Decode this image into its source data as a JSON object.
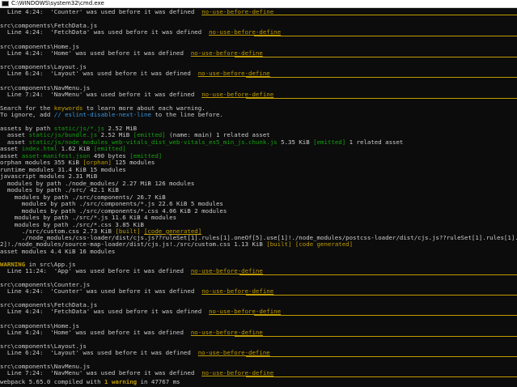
{
  "window": {
    "title": "C:\\WINDOWS\\system32\\cmd.exe"
  },
  "lines": {
    "l00": {
      "a": "  Line 4:24:  'Counter' was used before it was defined  ",
      "r": "no-use-before-define"
    },
    "l01": "src\\components\\FetchData.js",
    "l02": {
      "a": "  Line 4:24:  'FetchData' was used before it was defined  ",
      "r": "no-use-before-define"
    },
    "l03": "src\\components\\Home.js",
    "l04": {
      "a": "  Line 4:24:  'Home' was used before it was defined  ",
      "r": "no-use-before-define"
    },
    "l05": "src\\components\\Layout.js",
    "l06": {
      "a": "  Line 6:24:  'Layout' was used before it was defined  ",
      "r": "no-use-before-define"
    },
    "l07": "src\\components\\NavMenu.js",
    "l08": {
      "a": "  Line 7:24:  'NavMenu' was used before it was defined  ",
      "r": "no-use-before-define"
    },
    "l09": {
      "a": "Search for the ",
      "k": "keywords",
      "b": " to learn more about each warning."
    },
    "l10": {
      "a": "To ignore, add ",
      "k": "// eslint-disable-next-line",
      "b": " to the line before."
    },
    "l11": {
      "a": "assets by path ",
      "k": "static/js/*.js",
      "b": " 2.52 MiB"
    },
    "l12": {
      "a": "  asset ",
      "k": "static/js/bundle.js",
      "b": " 2.52 MiB ",
      "t": "[emitted]",
      "c": " (name: main) 1 related asset"
    },
    "l13": {
      "a": "  asset ",
      "k": "static/js/node_modules_web-vitals_dist_web-vitals_es5_min_js.chunk.js",
      "b": " 5.35 KiB ",
      "t": "[emitted]",
      "c": " 1 related asset"
    },
    "l14": {
      "a": "asset ",
      "k": "index.html",
      "b": " 1.62 KiB ",
      "t": "[emitted]"
    },
    "l15": {
      "a": "asset ",
      "k": "asset-manifest.json",
      "b": " 490 bytes ",
      "t": "[emitted]"
    },
    "l16": {
      "a": "orphan modules 355 KiB ",
      "t": "[orphan]",
      "b": " 125 modules"
    },
    "l17": "runtime modules 31.4 KiB 15 modules",
    "l18": "javascript modules 2.31 MiB",
    "l19": "  modules by path ./node_modules/ 2.27 MiB 126 modules",
    "l20": "  modules by path ./src/ 42.1 KiB",
    "l21": "    modules by path ./src/components/ 26.7 KiB",
    "l22": "      modules by path ./src/components/*.js 22.6 KiB 5 modules",
    "l23": "      modules by path ./src/components/*.css 4.06 KiB 2 modules",
    "l24": "    modules by path ./src/*.js 11.6 KiB 4 modules",
    "l25": "    modules by path ./src/*.css 3.85 KiB",
    "l26": {
      "a": "      ./src/custom.css 2.73 KiB ",
      "t": "[built]",
      "b": " ",
      "u": "[code generated]"
    },
    "l27": "      ./node_modules/css-loader/dist/cjs.js??ruleSet[1].rules[1].oneOf[5].use[1]!./node_modules/postcss-loader/dist/cjs.js??ruleSet[1].rules[1].oneOf[5].use[",
    "l28": {
      "a": "2]!./node_modules/source-map-loader/dist/cjs.js!./src/custom.css 1.13 KiB ",
      "t": "[built]",
      "b": " ",
      "u": "[code generated]"
    },
    "l29": "asset modules 4.4 KiB 16 modules",
    "l30": {
      "w": "WARNING",
      "a": " in src\\App.js"
    },
    "l31": {
      "a": "  Line 11:24:  'App' was used before it was defined  ",
      "r": "no-use-before-define"
    },
    "l32": "src\\components\\Counter.js",
    "l33": {
      "a": "  Line 4:24:  'Counter' was used before it was defined  ",
      "r": "no-use-before-define"
    },
    "l34": "src\\components\\FetchData.js",
    "l35": {
      "a": "  Line 4:24:  'FetchData' was used before it was defined  ",
      "r": "no-use-before-define"
    },
    "l36": "src\\components\\Home.js",
    "l37": {
      "a": "  Line 4:24:  'Home' was used before it was defined  ",
      "r": "no-use-before-define"
    },
    "l38": "src\\components\\Layout.js",
    "l39": {
      "a": "  Line 6:24:  'Layout' was used before it was defined  ",
      "r": "no-use-before-define"
    },
    "l40": "src\\components\\NavMenu.js",
    "l41": {
      "a": "  Line 7:24:  'NavMenu' was used before it was defined  ",
      "r": "no-use-before-define"
    },
    "l42": {
      "a": "webpack 5.65.0 compiled with ",
      "n": "1 warning",
      "b": " in 47767 ms"
    }
  },
  "colors": {
    "background": "#0c0c0c",
    "text": "#cccccc",
    "yellow": "#c19c00",
    "green": "#13a10e",
    "cyan": "#3a96dd",
    "white": "#ffffff"
  }
}
